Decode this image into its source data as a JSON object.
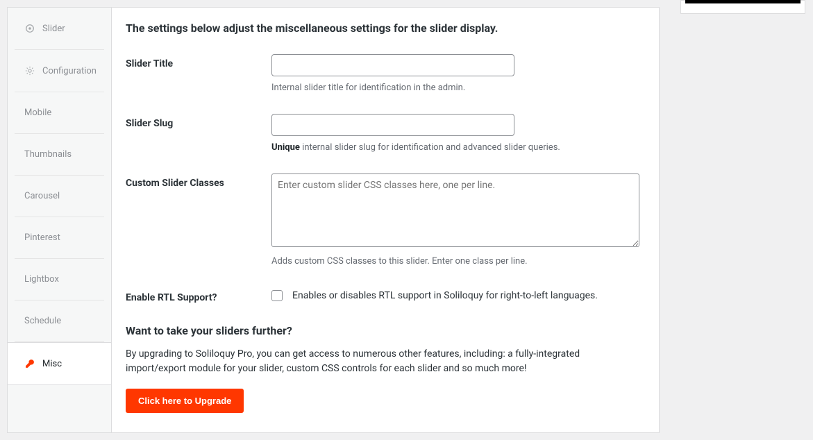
{
  "sidebar": {
    "items": [
      {
        "label": "Slider",
        "icon": "slider-icon"
      },
      {
        "label": "Configuration",
        "icon": "gear-icon"
      },
      {
        "label": "Mobile",
        "icon": ""
      },
      {
        "label": "Thumbnails",
        "icon": ""
      },
      {
        "label": "Carousel",
        "icon": ""
      },
      {
        "label": "Pinterest",
        "icon": ""
      },
      {
        "label": "Lightbox",
        "icon": ""
      },
      {
        "label": "Schedule",
        "icon": ""
      },
      {
        "label": "Misc",
        "icon": "wrench-icon"
      }
    ]
  },
  "content": {
    "title": "The settings below adjust the miscellaneous settings for the slider display.",
    "slider_title": {
      "label": "Slider Title",
      "value": "",
      "help": "Internal slider title for identification in the admin."
    },
    "slider_slug": {
      "label": "Slider Slug",
      "value": "",
      "help_strong": "Unique",
      "help_rest": " internal slider slug for identification and advanced slider queries."
    },
    "custom_classes": {
      "label": "Custom Slider Classes",
      "placeholder": "Enter custom slider CSS classes here, one per line.",
      "help": "Adds custom CSS classes to this slider. Enter one class per line."
    },
    "rtl": {
      "label": "Enable RTL Support?",
      "desc": "Enables or disables RTL support in Soliloquy for right-to-left languages."
    },
    "upgrade": {
      "heading": "Want to take your sliders further?",
      "text": "By upgrading to Soliloquy Pro, you can get access to numerous other features, including: a fully-integrated import/export module for your slider, custom CSS controls for each slider and so much more!",
      "button": "Click here to Upgrade"
    }
  }
}
